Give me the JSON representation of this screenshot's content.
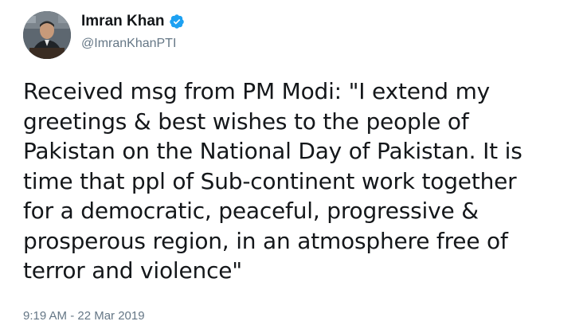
{
  "author": {
    "display_name": "Imran Khan",
    "handle": "@ImranKhanPTI",
    "verified": true,
    "verified_icon": "verified-badge-icon",
    "avatar_icon": "profile-avatar",
    "verified_color": "#1da1f2"
  },
  "tweet": {
    "lines": [
      "Received msg from PM Modi: \"I extend my",
      "greetings & best wishes to the people of",
      "Pakistan on the National Day of Pakistan. It is",
      "time that ppl of Sub-continent work together",
      "for a democratic, peaceful, progressive &",
      "prosperous region, in an atmosphere free of",
      "terror and violence\""
    ],
    "timestamp": "9:19 AM - 22 Mar 2019"
  },
  "colors": {
    "text": "#14171a",
    "secondary": "#657786",
    "background": "#ffffff"
  }
}
